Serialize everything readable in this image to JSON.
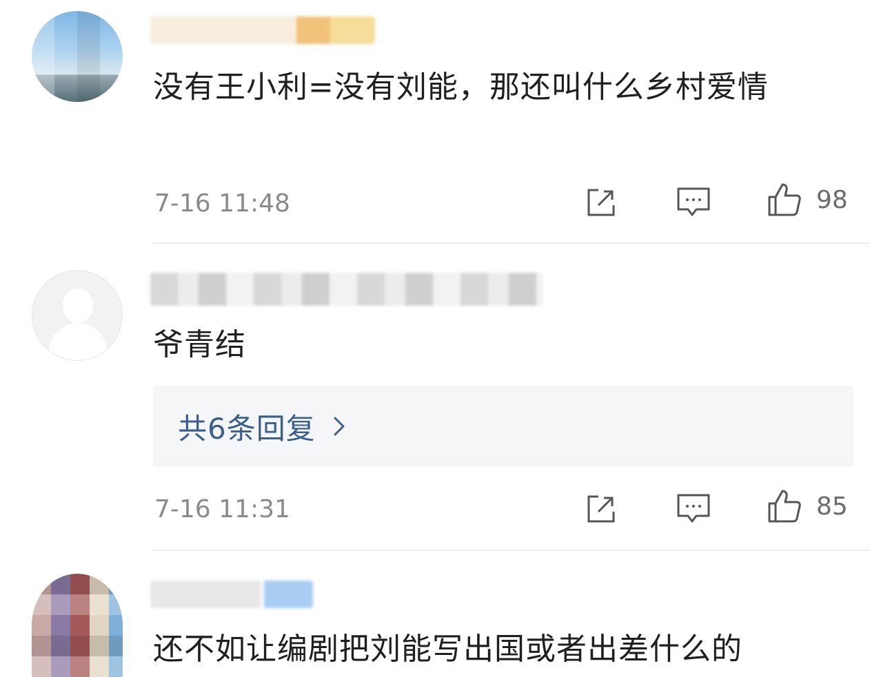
{
  "comments": [
    {
      "text": "没有王小利=没有刘能，那还叫什么乡村爱情",
      "time": "7-16 11:48",
      "likes": "98"
    },
    {
      "text": "爷青结",
      "time": "7-16 11:31",
      "likes": "85",
      "replies_label": "共6条回复"
    },
    {
      "text": "还不如让编剧把刘能写出国或者出差什么的"
    }
  ],
  "icons": {
    "share": "share-icon",
    "comment": "comment-icon",
    "like": "thumbs-up-icon",
    "chevron": "chevron-right-icon"
  },
  "colors": {
    "text": "#1f1f1f",
    "meta": "#8a8a8a",
    "link": "#3a5f8f",
    "reply_bg": "#f5f6f7"
  }
}
